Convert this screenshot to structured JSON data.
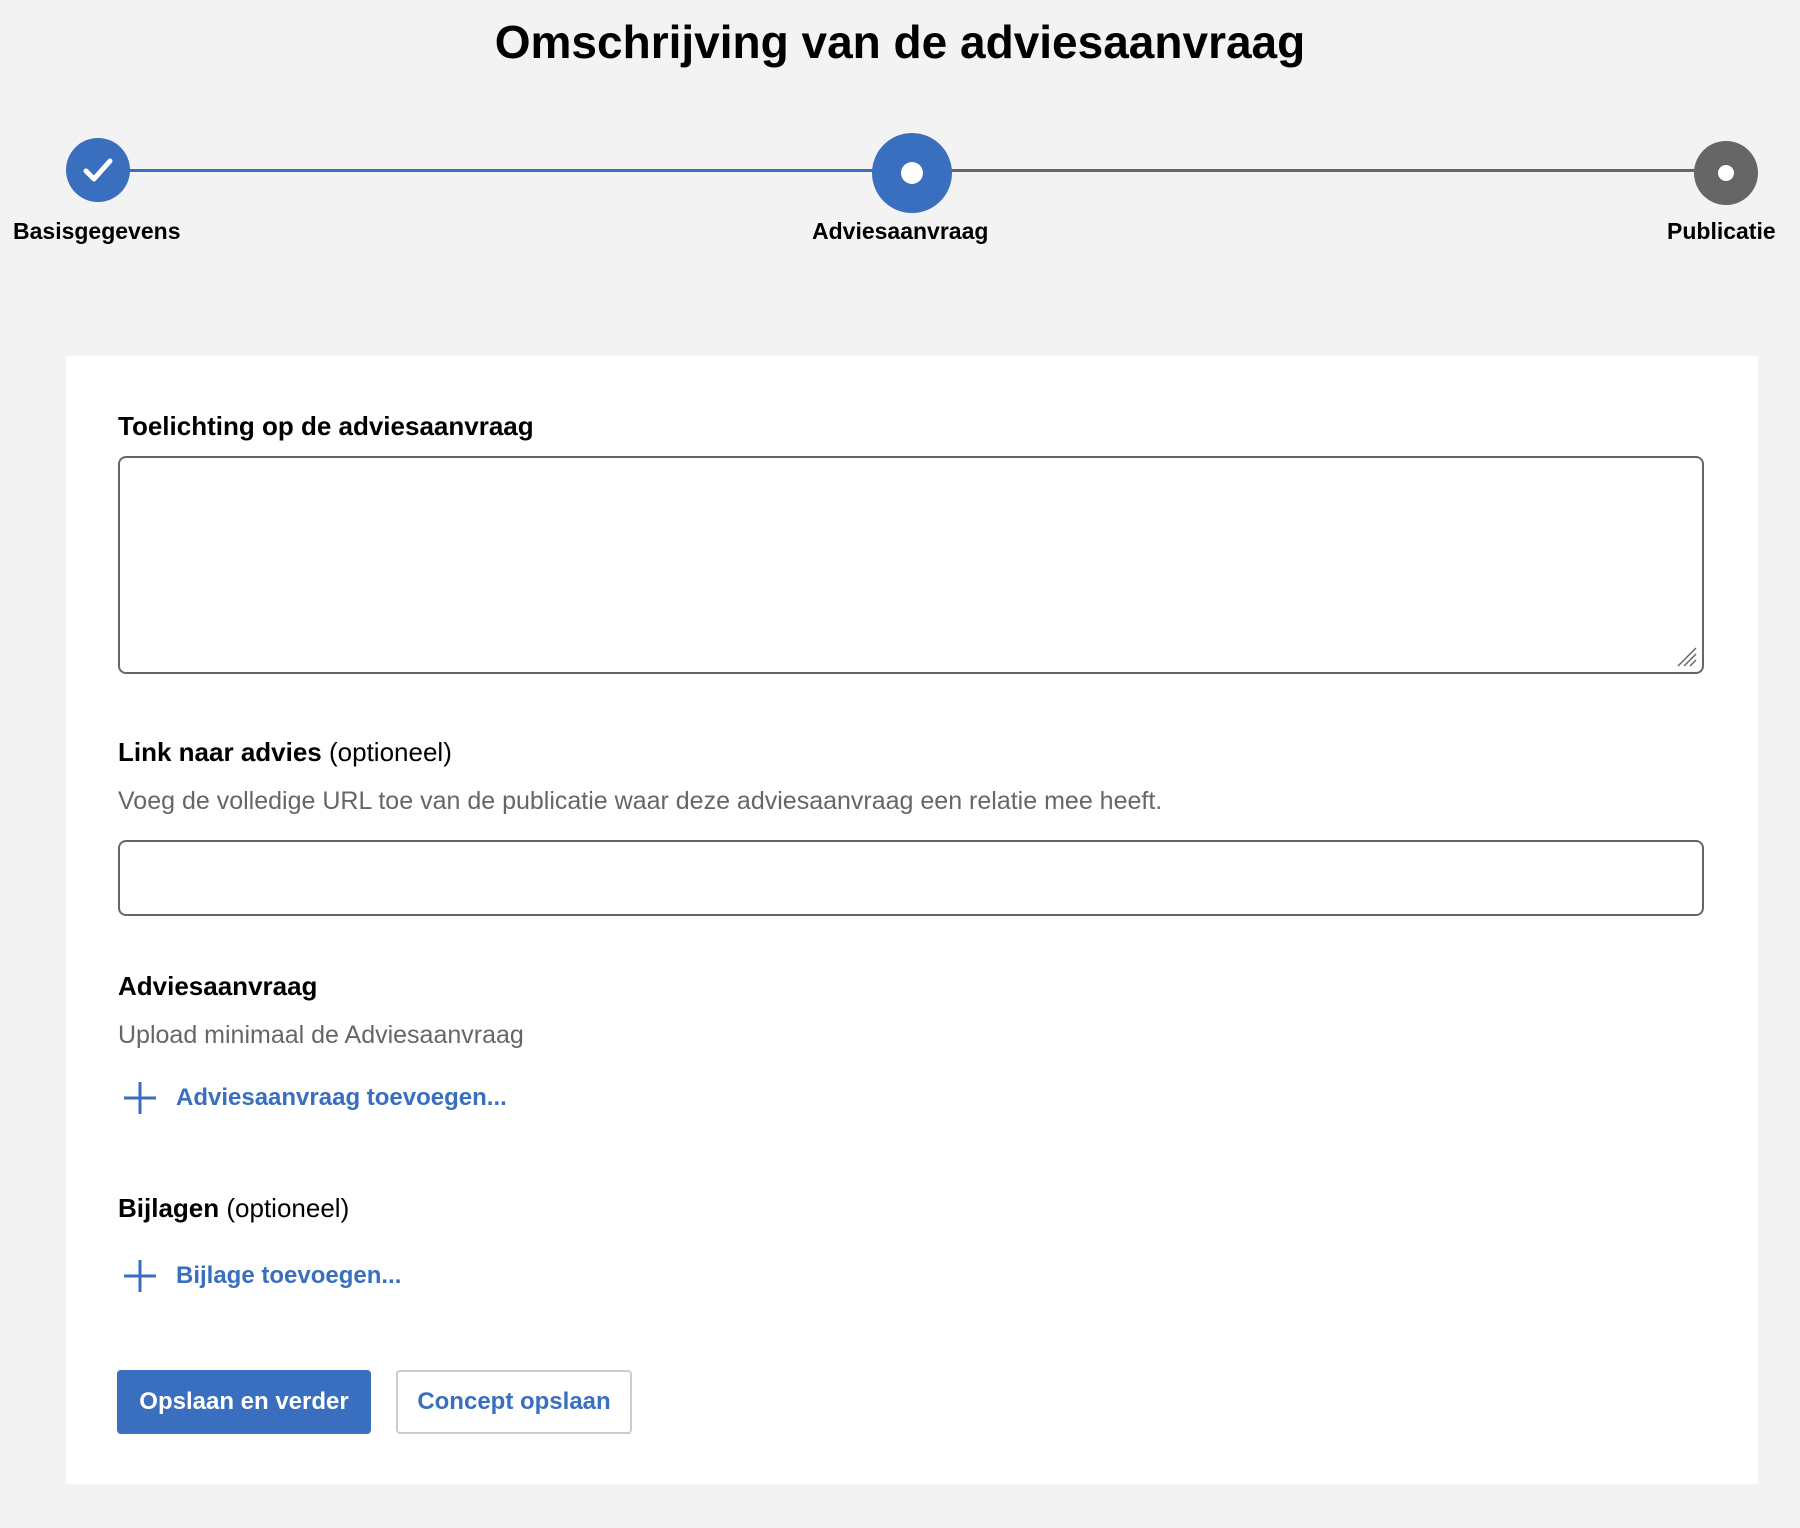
{
  "page": {
    "title": "Omschrijving van de adviesaanvraag"
  },
  "stepper": {
    "steps": [
      {
        "label": "Basisgegevens",
        "state": "done"
      },
      {
        "label": "Adviesaanvraag",
        "state": "current"
      },
      {
        "label": "Publicatie",
        "state": "todo"
      }
    ]
  },
  "form": {
    "toelichting": {
      "label": "Toelichting op de adviesaanvraag",
      "value": ""
    },
    "link": {
      "label": "Link naar advies",
      "optional": "(optioneel)",
      "hint": "Voeg de volledige URL toe van de publicatie waar deze adviesaanvraag een relatie mee heeft.",
      "value": ""
    },
    "adviesaanvraag": {
      "label": "Adviesaanvraag",
      "hint": "Upload minimaal de Adviesaanvraag",
      "add_label": "Adviesaanvraag toevoegen..."
    },
    "bijlagen": {
      "label": "Bijlagen",
      "optional": "(optioneel)",
      "add_label": "Bijlage toevoegen..."
    }
  },
  "actions": {
    "save_continue": "Opslaan en verder",
    "save_draft": "Concept opslaan"
  },
  "colors": {
    "accent": "#3a6fbf",
    "inactive": "#666666",
    "background": "#f3f3f3"
  }
}
